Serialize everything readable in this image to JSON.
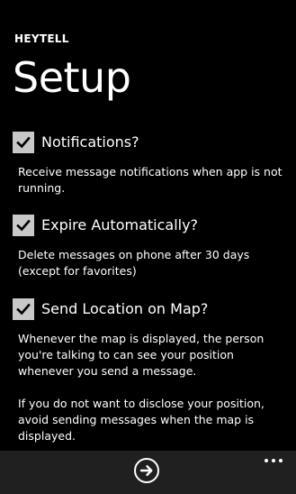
{
  "header": {
    "app_name": "HEYTELL",
    "page_title": "Setup"
  },
  "settings": [
    {
      "label": "Notifications?",
      "checked": true,
      "description": [
        "Receive message notifications when app is not running."
      ]
    },
    {
      "label": "Expire Automatically?",
      "checked": true,
      "description": [
        "Delete messages on phone after 30 days (except for favorites)"
      ]
    },
    {
      "label": "Send Location on Map?",
      "checked": true,
      "description": [
        "Whenever the map is displayed, the person you're talking to can see your position whenever you send a message.",
        "If you do not want to disclose your position, avoid sending messages when the map is displayed."
      ]
    }
  ],
  "app_bar": {
    "next_icon": "arrow-right-circle-icon",
    "more_icon": "ellipsis-icon"
  },
  "colors": {
    "background": "#000000",
    "text": "#ffffff",
    "checkbox": "#c8c8c8",
    "app_bar": "#212021"
  }
}
